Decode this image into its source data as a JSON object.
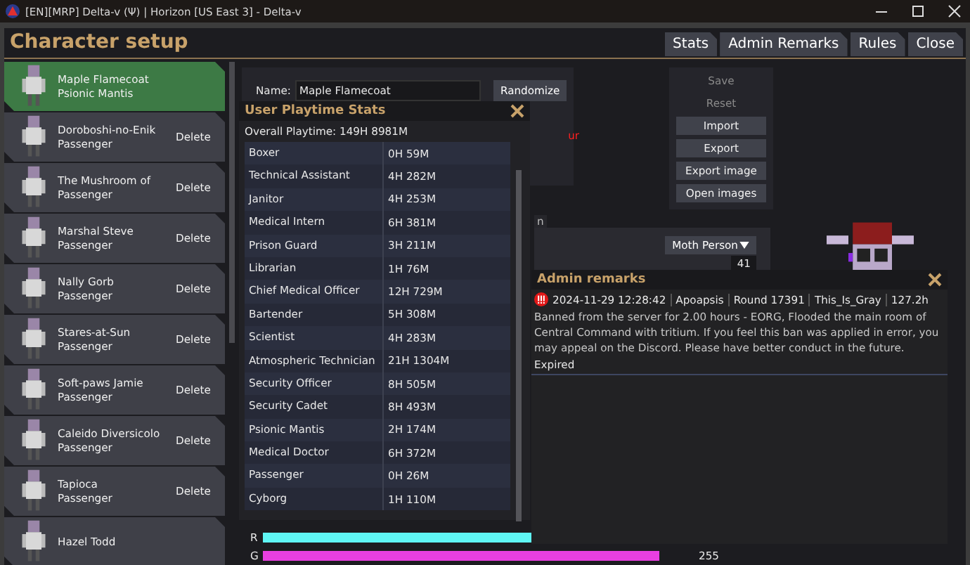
{
  "window": {
    "title": "[EN][MRP] Delta-v (Ψ) | Horizon [US East 3] - Delta-v"
  },
  "header": {
    "title": "Character setup",
    "tabs": [
      {
        "label": "Stats"
      },
      {
        "label": "Admin Remarks"
      },
      {
        "label": "Rules"
      },
      {
        "label": "Close"
      }
    ]
  },
  "characters": [
    {
      "name": "Maple Flamecoat",
      "job": "Psionic Mantis",
      "selected": true
    },
    {
      "name": "Doroboshi-no-Enik",
      "job": "Passenger",
      "selected": false,
      "delete": "Delete"
    },
    {
      "name": "The Mushroom of",
      "job": "Passenger",
      "selected": false,
      "delete": "Delete"
    },
    {
      "name": "Marshal Steve",
      "job": "Passenger",
      "selected": false,
      "delete": "Delete"
    },
    {
      "name": "Nally Gorb",
      "job": "Passenger",
      "selected": false,
      "delete": "Delete"
    },
    {
      "name": "Stares-at-Sun",
      "job": "Passenger",
      "selected": false,
      "delete": "Delete"
    },
    {
      "name": "Soft-paws Jamie",
      "job": "Passenger",
      "selected": false,
      "delete": "Delete"
    },
    {
      "name": "Caleido Diversicolo",
      "job": "Passenger",
      "selected": false,
      "delete": "Delete"
    },
    {
      "name": "Tapioca",
      "job": "Passenger",
      "selected": false,
      "delete": "Delete"
    },
    {
      "name": "Hazel Todd",
      "selected": false
    }
  ],
  "editor": {
    "name_label": "Name:",
    "name_value": "Maple Flamecoat",
    "randomize": "Randomize",
    "fragment_1": "ur",
    "fragment_2": "n",
    "actions": [
      {
        "label": "Save",
        "disabled": true
      },
      {
        "label": "Reset",
        "disabled": true
      },
      {
        "label": "Import",
        "disabled": false
      },
      {
        "label": "Export",
        "disabled": false
      },
      {
        "label": "Export image",
        "disabled": false
      },
      {
        "label": "Open images",
        "disabled": false
      }
    ],
    "species": "Moth Person",
    "age": "41",
    "sliders": [
      {
        "label": "R",
        "level": 1,
        "color": "#5ff6f4"
      },
      {
        "label": "G",
        "level": 1,
        "color": "#e83fe0",
        "reading": "255"
      }
    ]
  },
  "playtime": {
    "title": "User Playtime Stats",
    "overall": "Overall Playtime: 149H 8981M",
    "rows": [
      {
        "role": "Boxer",
        "time": "0H 59M"
      },
      {
        "role": "Technical Assistant",
        "time": "4H 282M"
      },
      {
        "role": "Janitor",
        "time": "4H 253M"
      },
      {
        "role": "Medical Intern",
        "time": "6H 381M"
      },
      {
        "role": "Prison Guard",
        "time": "3H 211M"
      },
      {
        "role": "Librarian",
        "time": "1H 76M"
      },
      {
        "role": "Chief Medical Officer",
        "time": "12H 729M"
      },
      {
        "role": "Bartender",
        "time": "5H 308M"
      },
      {
        "role": "Scientist",
        "time": "4H 283M"
      },
      {
        "role": "Atmospheric Technician",
        "time": "21H 1304M"
      },
      {
        "role": "Security Officer",
        "time": "8H 505M"
      },
      {
        "role": "Security Cadet",
        "time": "8H 493M"
      },
      {
        "role": "Psionic Mantis",
        "time": "2H 174M"
      },
      {
        "role": "Medical Doctor",
        "time": "6H 372M"
      },
      {
        "role": "Passenger",
        "time": "0H 26M"
      },
      {
        "role": "Cyborg",
        "time": "1H 110M"
      }
    ]
  },
  "admin_remarks": {
    "title": "Admin remarks",
    "entries": [
      {
        "date": "2024-11-29 12:28:42",
        "admin": "Apoapsis",
        "round": "Round 17391",
        "player": "This_Is_Gray",
        "playtime": "127.2h",
        "message": "Banned from the server for 2.00 hours - EORG, Flooded the main room of Central Command with tritium. If you feel this ban was applied in error, you may appeal on the Discord. Please have better conduct in the future.",
        "status": "Expired"
      }
    ]
  }
}
